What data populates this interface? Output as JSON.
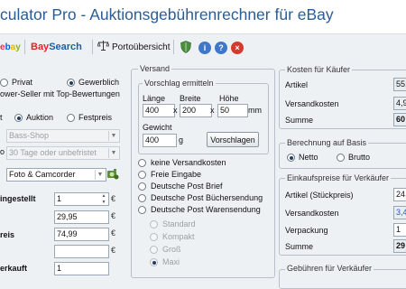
{
  "window": {
    "title": "culator Pro - Auktionsgebührenrechner für eBay"
  },
  "toolbar": {
    "ebay_label": "ebay",
    "baysearch_label": "BaySearch",
    "porto_label": "Portoübersicht",
    "icons": [
      "ebay-logo-icon",
      "baysearch-logo-icon",
      "scale-icon",
      "shield-icon",
      "info-icon",
      "help-icon",
      "close-icon"
    ]
  },
  "left": {
    "private_label": "Privat",
    "commercial_label": "Gewerblich",
    "powerseller_text": "ower-Seller mit Top-Bewertungen",
    "type_label": "t",
    "auction_label": "Auktion",
    "fixed_label": "Festpreis",
    "shop_select": "Bass-Shop",
    "duration_label": "o",
    "duration_select": "30 Tage oder unbefristet",
    "category_select": "Foto & Camcorder",
    "quantity_label": "ingestellt",
    "quantity_value": "1",
    "start_price_value": "29,95",
    "price_label": "reis",
    "price_value": "74,99",
    "sold_label": "erkauft",
    "sold_value": "1",
    "euro": "€"
  },
  "shipping": {
    "group_title": "Versand",
    "suggest_title": "Vorschlag ermitteln",
    "length_label": "Länge",
    "width_label": "Breite",
    "height_label": "Höhe",
    "length_value": "400",
    "width_value": "200",
    "height_value": "50",
    "times": "x",
    "unit_mm": "mm",
    "weight_label": "Gewicht",
    "weight_value": "400",
    "unit_g": "g",
    "suggest_button": "Vorschlagen",
    "options": [
      {
        "label": "keine Versandkosten",
        "checked": false,
        "disabled": false
      },
      {
        "label": "Freie Eingabe",
        "checked": false,
        "disabled": false
      },
      {
        "label": "Deutsche Post Brief",
        "checked": false,
        "disabled": false
      },
      {
        "label": "Deutsche Post Büchersendung",
        "checked": false,
        "disabled": false
      },
      {
        "label": "Deutsche Post Warensendung",
        "checked": false,
        "disabled": false
      }
    ],
    "sub_options": [
      {
        "label": "Standard",
        "checked": false
      },
      {
        "label": "Kompakt",
        "checked": false
      },
      {
        "label": "Groß",
        "checked": false
      },
      {
        "label": "Maxi",
        "checked": true
      }
    ]
  },
  "buyer_costs": {
    "group_title": "Kosten für Käufer",
    "article_label": "Artikel",
    "article_value": "55,",
    "shipping_label": "Versandkosten",
    "shipping_value": "4,9",
    "sum_label": "Summe",
    "sum_value": "60"
  },
  "calc_basis": {
    "group_title": "Berechnung auf Basis",
    "net_label": "Netto",
    "gross_label": "Brutto"
  },
  "purchase": {
    "group_title": "Einkaufspreise für Verkäufer",
    "article_label": "Artikel (Stückpreis)",
    "article_value": "24,",
    "shipping_label": "Versandkosten",
    "shipping_value": "3,4",
    "packaging_label": "Verpackung",
    "packaging_value": "1",
    "sum_label": "Summe",
    "sum_value": "29"
  },
  "seller_fees": {
    "group_title": "Gebühren für Verkäufer"
  },
  "colors": {
    "title_blue": "#2b5c96",
    "ebay_red": "#e53238",
    "ebay_blue": "#0064d2",
    "baysearch_red": "#d9262b",
    "baysearch_blue": "#1d5fa8"
  }
}
